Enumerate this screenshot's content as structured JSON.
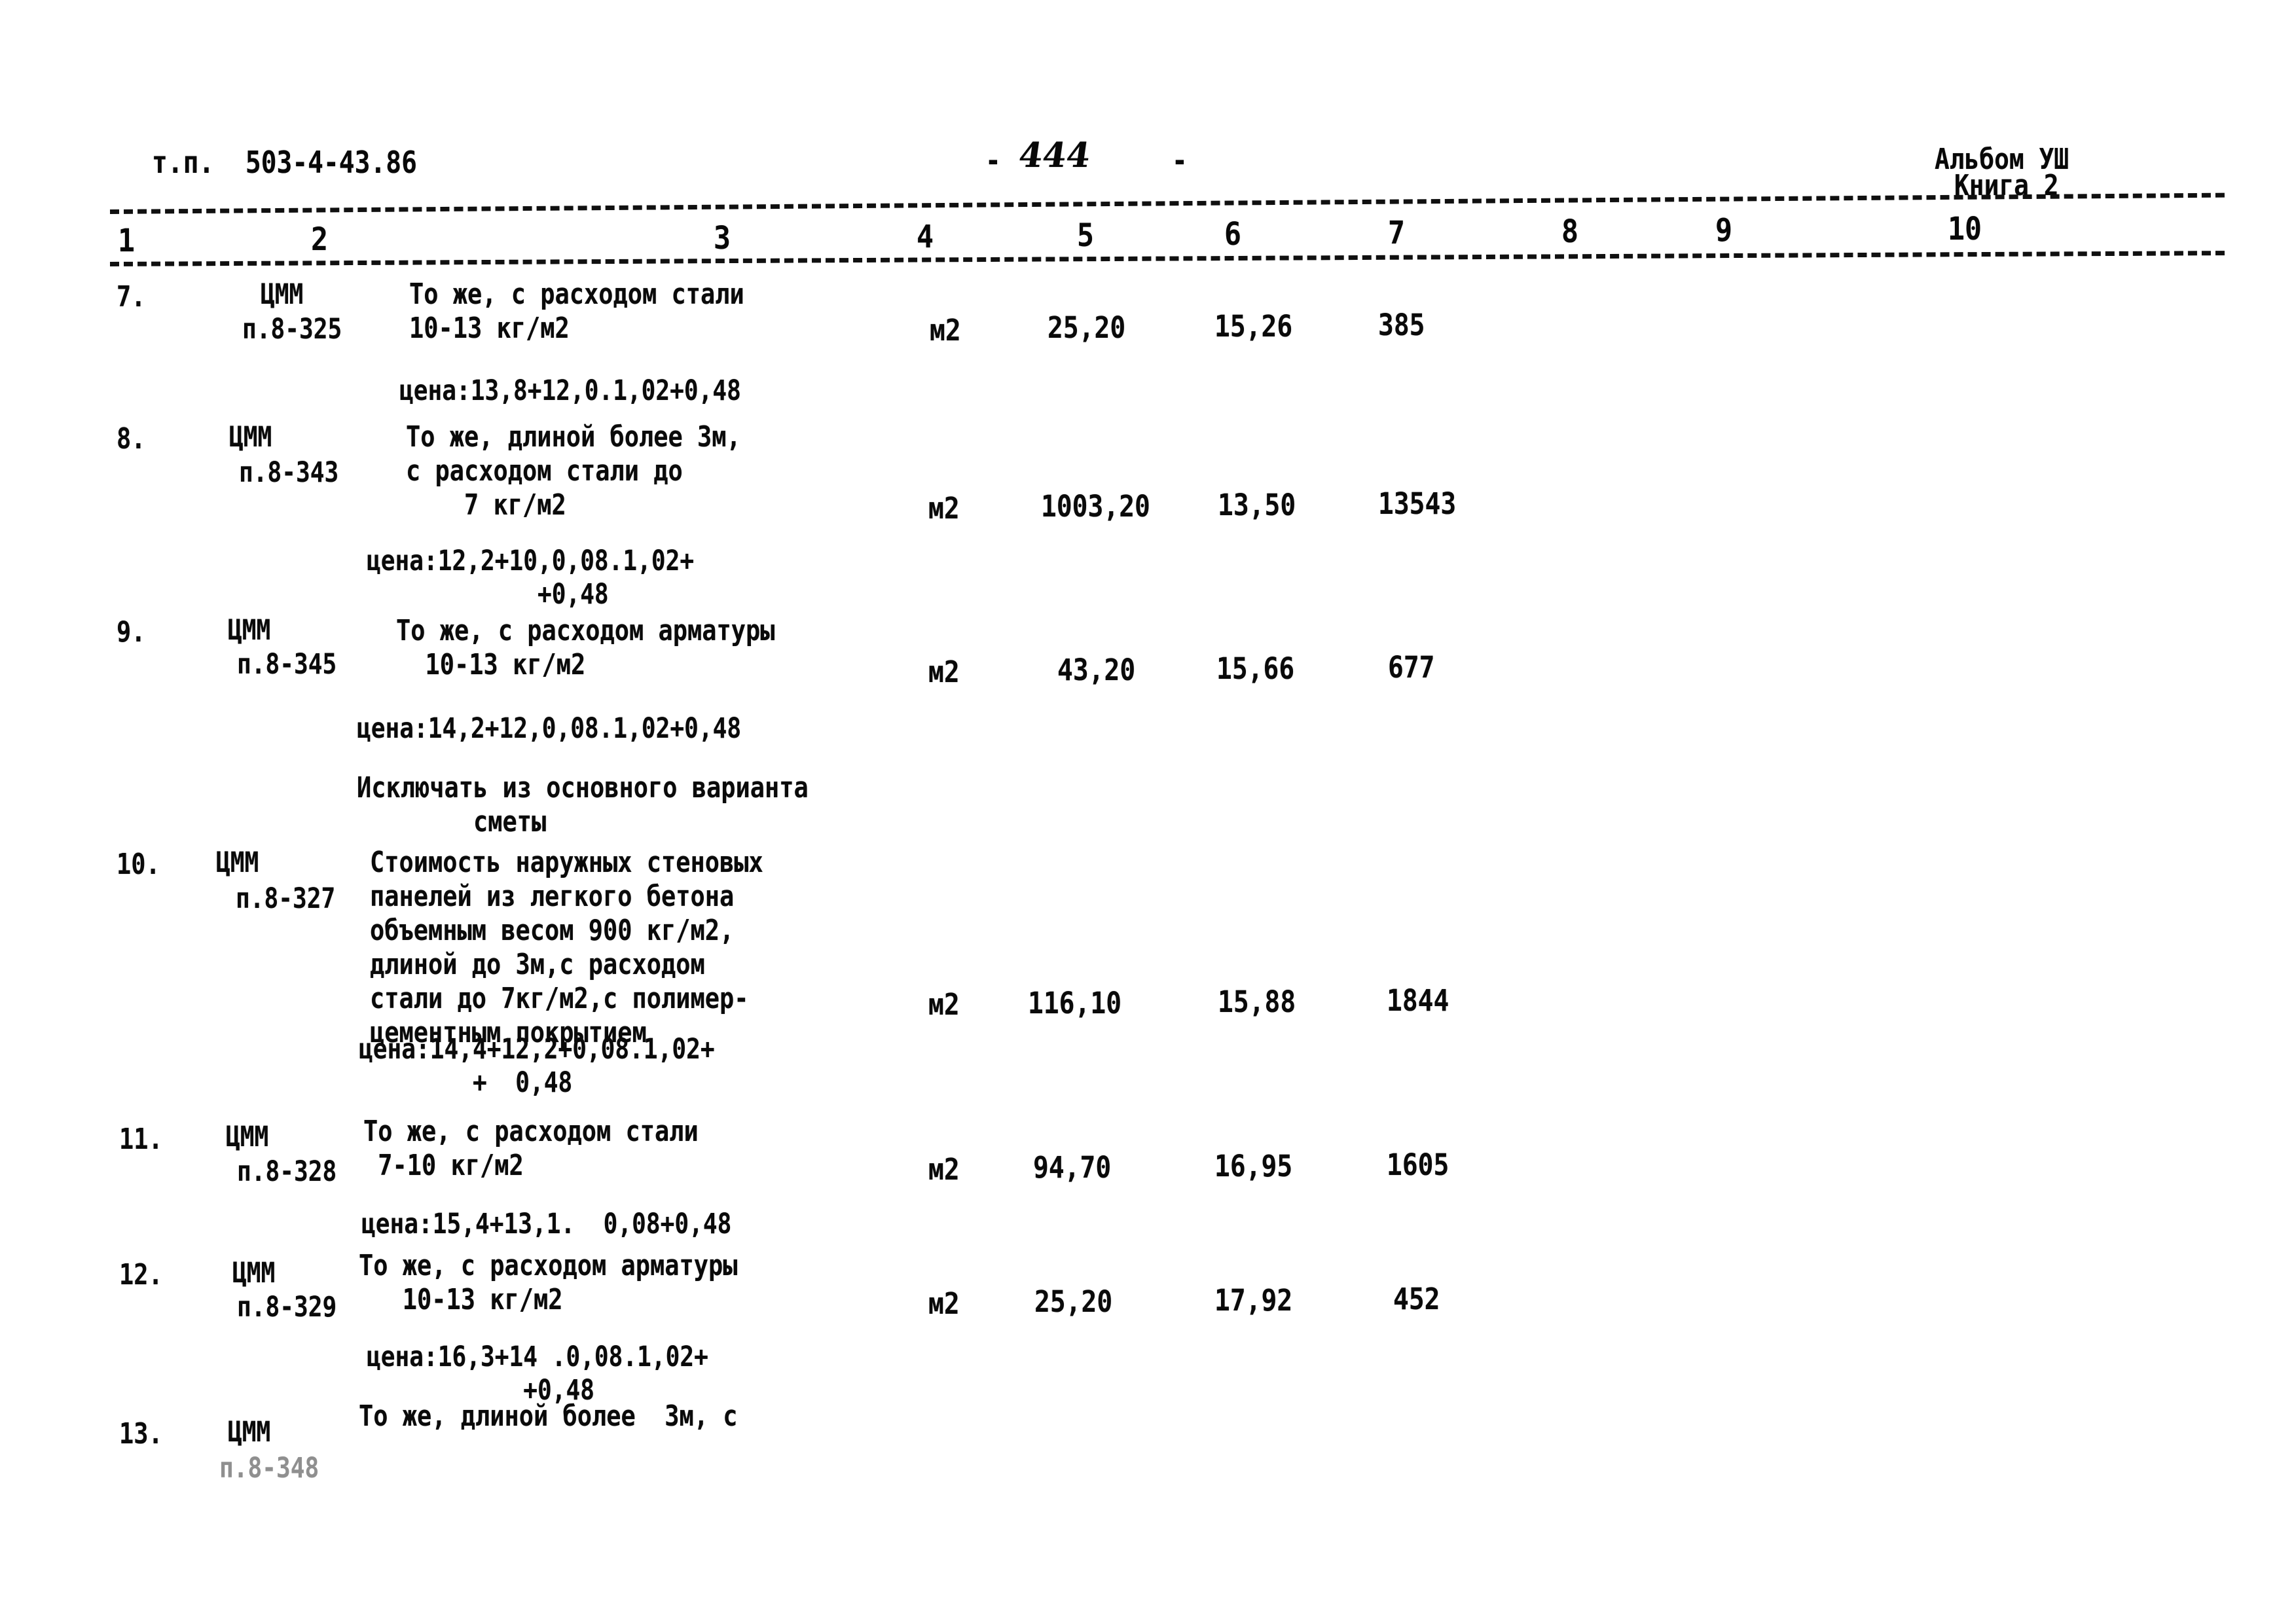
{
  "header": {
    "doc_code": "т.п.  503-4-43.86",
    "page_number_dash_left": "-",
    "page_number": "444",
    "page_number_dash_right": "-",
    "album": "Альбом УШ",
    "book": "Книга 2"
  },
  "table": {
    "column_numbers": [
      "1",
      "2",
      "3",
      "4",
      "5",
      "6",
      "7",
      "8",
      "9",
      "10"
    ],
    "rows": [
      {
        "num": "7.",
        "code_line1": "ЦММ",
        "code_line2": "п.8-325",
        "description": "То же, с расходом стали\n10-13 кг/м2",
        "unit": "м2",
        "col5": "25,20",
        "col6": "15,26",
        "col7": "385",
        "col8": "",
        "col9": "",
        "col10": "",
        "price": "цена:13,8+12,0.1,02+0,48"
      },
      {
        "num": "8.",
        "code_line1": "ЦММ",
        "code_line2": "п.8-343",
        "description": "То же, длиной более 3м,\nс расходом стали до\n    7 кг/м2",
        "unit": "м2",
        "col5": "1003,20",
        "col6": "13,50",
        "col7": "13543",
        "col8": "",
        "col9": "",
        "col10": "",
        "price": "цена:12,2+10,0,08.1,02+\n            +0,48"
      },
      {
        "num": "9.",
        "code_line1": "ЦММ",
        "code_line2": "п.8-345",
        "description": "То же, с расходом арматуры\n  10-13 кг/м2",
        "unit": "м2",
        "col5": "43,20",
        "col6": "15,66",
        "col7": "677",
        "col8": "",
        "col9": "",
        "col10": "",
        "price": "цена:14,2+12,0,08.1,02+0,48"
      },
      {
        "num": "10.",
        "code_line1": "ЦММ",
        "code_line2": "п.8-327",
        "description": "Стоимость наружных стеновых\nпанелей из легкого бетона\nобъемным весом 900 кг/м2,\nдлиной до 3м,с расходом\nстали до 7кг/м2,с полимер-\nцементным покрытием",
        "unit": "м2",
        "col5": "116,10",
        "col6": "15,88",
        "col7": "1844",
        "col8": "",
        "col9": "",
        "col10": "",
        "price": "цена:14,4+12,2+0,08.1,02+\n        +  0,48"
      },
      {
        "num": "11.",
        "code_line1": "ЦММ",
        "code_line2": "п.8-328",
        "description": "То же, с расходом стали\n 7-10 кг/м2",
        "unit": "м2",
        "col5": "94,70",
        "col6": "16,95",
        "col7": "1605",
        "col8": "",
        "col9": "",
        "col10": "",
        "price": "цена:15,4+13,1.  0,08+0,48"
      },
      {
        "num": "12.",
        "code_line1": "ЦММ",
        "code_line2": "п.8-329",
        "description": "То же, с расходом арматуры\n   10-13 кг/м2",
        "unit": "м2",
        "col5": "25,20",
        "col6": "17,92",
        "col7": "452",
        "col8": "",
        "col9": "",
        "col10": "",
        "price": "цена:16,3+14 .0,08.1,02+\n           +0,48"
      },
      {
        "num": "13.",
        "code_line1": "ЦММ",
        "code_line2": "п.8-348",
        "description": "То же, длиной более  3м, с",
        "unit": "",
        "col5": "",
        "col6": "",
        "col7": "",
        "col8": "",
        "col9": "",
        "col10": "",
        "price": ""
      }
    ],
    "note": "Исключать из основного варианта\n        сметы"
  }
}
